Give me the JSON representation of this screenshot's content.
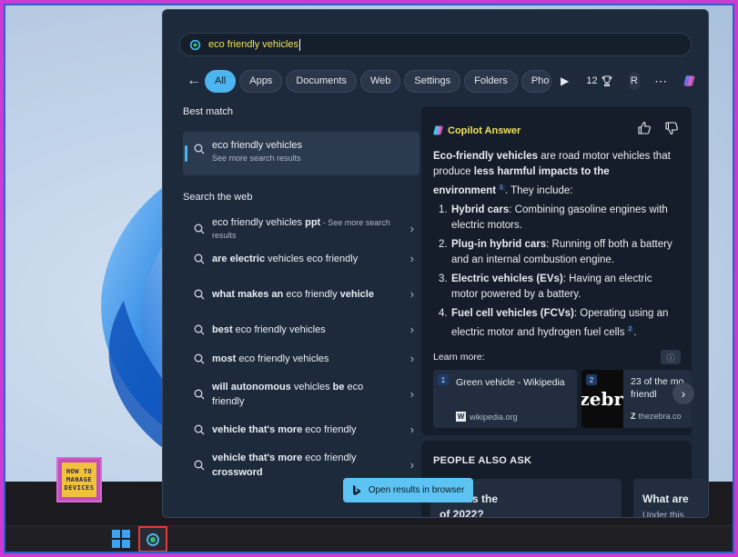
{
  "search": {
    "query": "eco friendly vehicles"
  },
  "filters": {
    "tabs": [
      {
        "label": "All",
        "active": true
      },
      {
        "label": "Apps"
      },
      {
        "label": "Documents"
      },
      {
        "label": "Web"
      },
      {
        "label": "Settings"
      },
      {
        "label": "Folders"
      },
      {
        "label": "Pho"
      }
    ],
    "points": "12",
    "avatar": "R"
  },
  "left": {
    "best_match_title": "Best match",
    "best_match": {
      "title": "eco friendly vehicles",
      "subtitle": "See more search results"
    },
    "web_title": "Search the web",
    "web_results": [
      {
        "bold": "",
        "text": "eco friendly vehicles ",
        "bold2": "ppt",
        "sub": " - See more search results"
      },
      {
        "bold": "are electric",
        "text": " vehicles eco friendly"
      },
      {
        "bold": "what makes an",
        "text": " eco friendly ",
        "bold2": "vehicle"
      },
      {
        "bold": "best",
        "text": " eco friendly vehicles"
      },
      {
        "bold": "most",
        "text": " eco friendly vehicles"
      },
      {
        "bold": "will autonomous",
        "text": " vehicles ",
        "bold2": "be",
        "text2": " eco friendly"
      },
      {
        "bold": "vehicle that's more",
        "text": " eco friendly"
      },
      {
        "bold": "vehicle that's more",
        "text": " eco friendly ",
        "bold2": "crossword"
      }
    ]
  },
  "answer": {
    "heading": "Copilot Answer",
    "intro_bold1": "Eco-friendly vehicles",
    "intro_text1": " are road motor vehicles that produce ",
    "intro_bold2": "less harmful impacts to the environment",
    "intro_ref": "1",
    "intro_text2": ". They include:",
    "items": [
      {
        "n": "1.",
        "bold": "Hybrid cars",
        "text": ": Combining gasoline engines with electric motors."
      },
      {
        "n": "2.",
        "bold": "Plug-in hybrid cars",
        "text": ": Running off both a battery and an internal combustion engine."
      },
      {
        "n": "3.",
        "bold": "Electric vehicles (EVs)",
        "text": ": Having an electric motor powered by a battery."
      },
      {
        "n": "4.",
        "bold": "Fuel cell vehicles (FCVs)",
        "text": ": Operating using an electric motor and hydrogen fuel cells",
        "ref": "2",
        "tail": "."
      }
    ],
    "learn_more": "Learn more:",
    "sources": [
      {
        "num": "1",
        "title": "Green vehicle - Wikipedia",
        "site": "wikipedia.org",
        "site_icon": "W"
      },
      {
        "num": "2",
        "title_line1": "23 of the mo",
        "title_line2": "friendl",
        "site": "thezebra.co",
        "site_icon": "Z",
        "image_text": "zebr"
      }
    ]
  },
  "people_also_ask": {
    "title": "PEOPLE ALSO ASK",
    "q1_line1": "What is the",
    "q1_line2": "of 2022?",
    "q2_line1": "What are",
    "q2_sub": "Under this"
  },
  "open_in_browser": "Open results in browser",
  "logo": {
    "line1": "HOW TO",
    "line2": "MANAGE",
    "line3": "DEVICES"
  },
  "colors": {
    "accent": "#4cb5f0",
    "highlight": "#f0e15a",
    "panel": "#1d2a3c",
    "border": "#c93bd1"
  }
}
